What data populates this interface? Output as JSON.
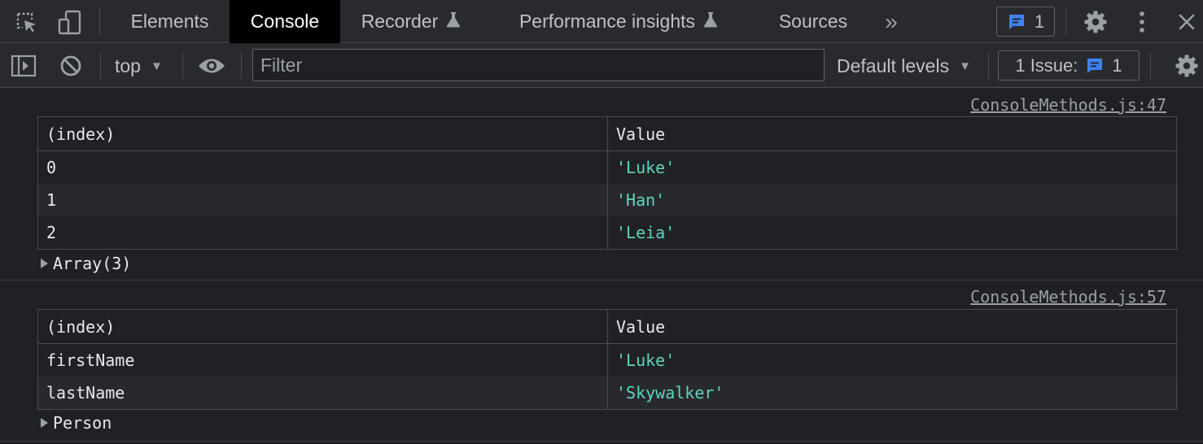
{
  "tabs": [
    {
      "label": "Elements",
      "active": false,
      "experimental": false
    },
    {
      "label": "Console",
      "active": true,
      "experimental": false
    },
    {
      "label": "Recorder",
      "active": false,
      "experimental": true
    },
    {
      "label": "Performance insights",
      "active": false,
      "experimental": true
    },
    {
      "label": "Sources",
      "active": false,
      "experimental": false
    }
  ],
  "tabbar": {
    "more_tabs_glyph": "»",
    "messages_badge_count": "1",
    "icons": [
      "inspect-element-icon",
      "device-toggle-icon",
      "message-icon",
      "settings-gear-icon",
      "kebab-menu-icon",
      "close-icon"
    ]
  },
  "toolbar": {
    "context": "top",
    "filter_placeholder": "Filter",
    "levels": "Default levels",
    "issues_label": "1 Issue:",
    "issues_count": "1",
    "icons": [
      "sidebar-toggle-icon",
      "clear-console-icon",
      "live-expression-eye-icon",
      "console-settings-gear-icon"
    ]
  },
  "colors": {
    "accent_blue": "#3c82f6",
    "string_value": "#5cd5c0",
    "panel_bg": "#202124",
    "toolbar_bg": "#292a2d"
  },
  "messages": [
    {
      "source": "ConsoleMethods.js:47",
      "headers": [
        "(index)",
        "Value"
      ],
      "rows": [
        [
          "0",
          "'Luke'"
        ],
        [
          "1",
          "'Han'"
        ],
        [
          "2",
          "'Leia'"
        ]
      ],
      "object_label": "Array(3)"
    },
    {
      "source": "ConsoleMethods.js:57",
      "headers": [
        "(index)",
        "Value"
      ],
      "rows": [
        [
          "firstName",
          "'Luke'"
        ],
        [
          "lastName",
          "'Skywalker'"
        ]
      ],
      "object_label": "Person"
    }
  ]
}
